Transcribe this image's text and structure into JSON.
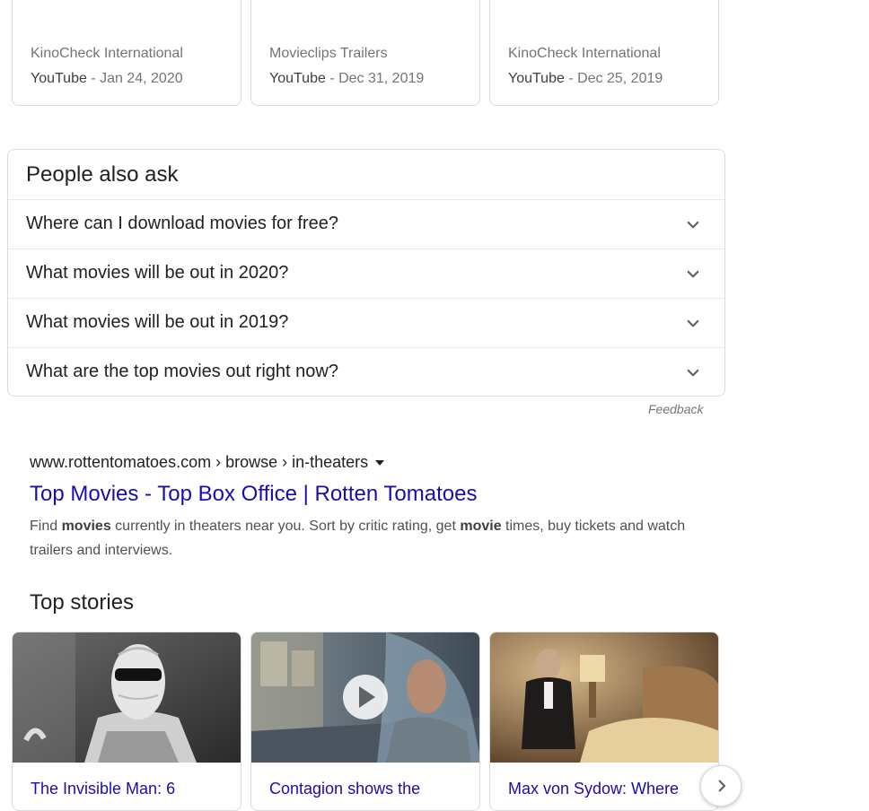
{
  "videos": [
    {
      "channel": "KinoCheck International",
      "source": "YouTube",
      "separator": " - ",
      "date": "Jan 24, 2020"
    },
    {
      "channel": "Movieclips Trailers",
      "source": "YouTube",
      "separator": " - ",
      "date": "Dec 31, 2019"
    },
    {
      "channel": "KinoCheck International",
      "source": "YouTube",
      "separator": " - ",
      "date": "Dec 25, 2019"
    }
  ],
  "people_also_ask": {
    "title": "People also ask",
    "questions": [
      "Where can I download movies for free?",
      "What movies will be out in 2020?",
      "What movies will be out in 2019?",
      "What are the top movies out right now?"
    ],
    "feedback_label": "Feedback"
  },
  "result": {
    "breadcrumb": "www.rottentomatoes.com › browse › in-theaters",
    "title": "Top Movies - Top Box Office | Rotten Tomatoes",
    "snippet_parts": [
      "Find ",
      "movies",
      " currently in theaters near you. Sort by critic rating, get ",
      "movie",
      " times, buy tickets and watch trailers and interviews."
    ]
  },
  "top_stories": {
    "title": "Top stories",
    "stories": [
      {
        "headline": "The Invisible Man: 6"
      },
      {
        "headline": "Contagion shows the"
      },
      {
        "headline": "Max von Sydow: Where"
      }
    ]
  },
  "colors": {
    "link": "#1a0dab",
    "muted": "#70757a",
    "border": "#dadce0"
  },
  "icons": {
    "expand": "chevron-down-icon",
    "play": "play-icon",
    "next": "chevron-right-icon",
    "dropdown": "caret-down-icon"
  }
}
